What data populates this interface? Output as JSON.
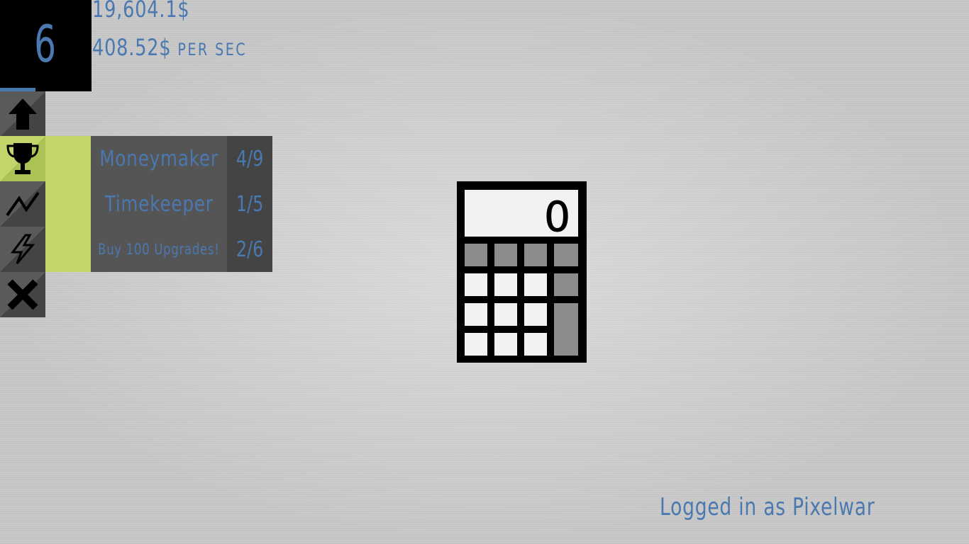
{
  "hud": {
    "level": "6",
    "money": "19,604.1$",
    "rate_value": "408.52$",
    "rate_unit": "per sec"
  },
  "sidebar": {
    "items": [
      {
        "name": "upgrades",
        "icon": "arrow-up-icon",
        "active": false
      },
      {
        "name": "achievements",
        "icon": "trophy-icon",
        "active": true
      },
      {
        "name": "stats",
        "icon": "chart-line-icon",
        "active": false
      },
      {
        "name": "boost",
        "icon": "lightning-icon",
        "active": false
      },
      {
        "name": "close",
        "icon": "close-icon",
        "active": false
      }
    ]
  },
  "achievements": [
    {
      "name": "Moneymaker",
      "progress": "4/9"
    },
    {
      "name": "Timekeeper",
      "progress": "1/5"
    },
    {
      "name": "Buy 100 Upgrades!",
      "progress": "2/6"
    }
  ],
  "calculator": {
    "display": "0"
  },
  "footer": {
    "login": "Logged in as Pixelwar"
  },
  "colors": {
    "accent_blue": "#4a78b0",
    "active_green": "#c2d66b",
    "panel_dark": "#444444",
    "panel_mid": "#555555"
  }
}
